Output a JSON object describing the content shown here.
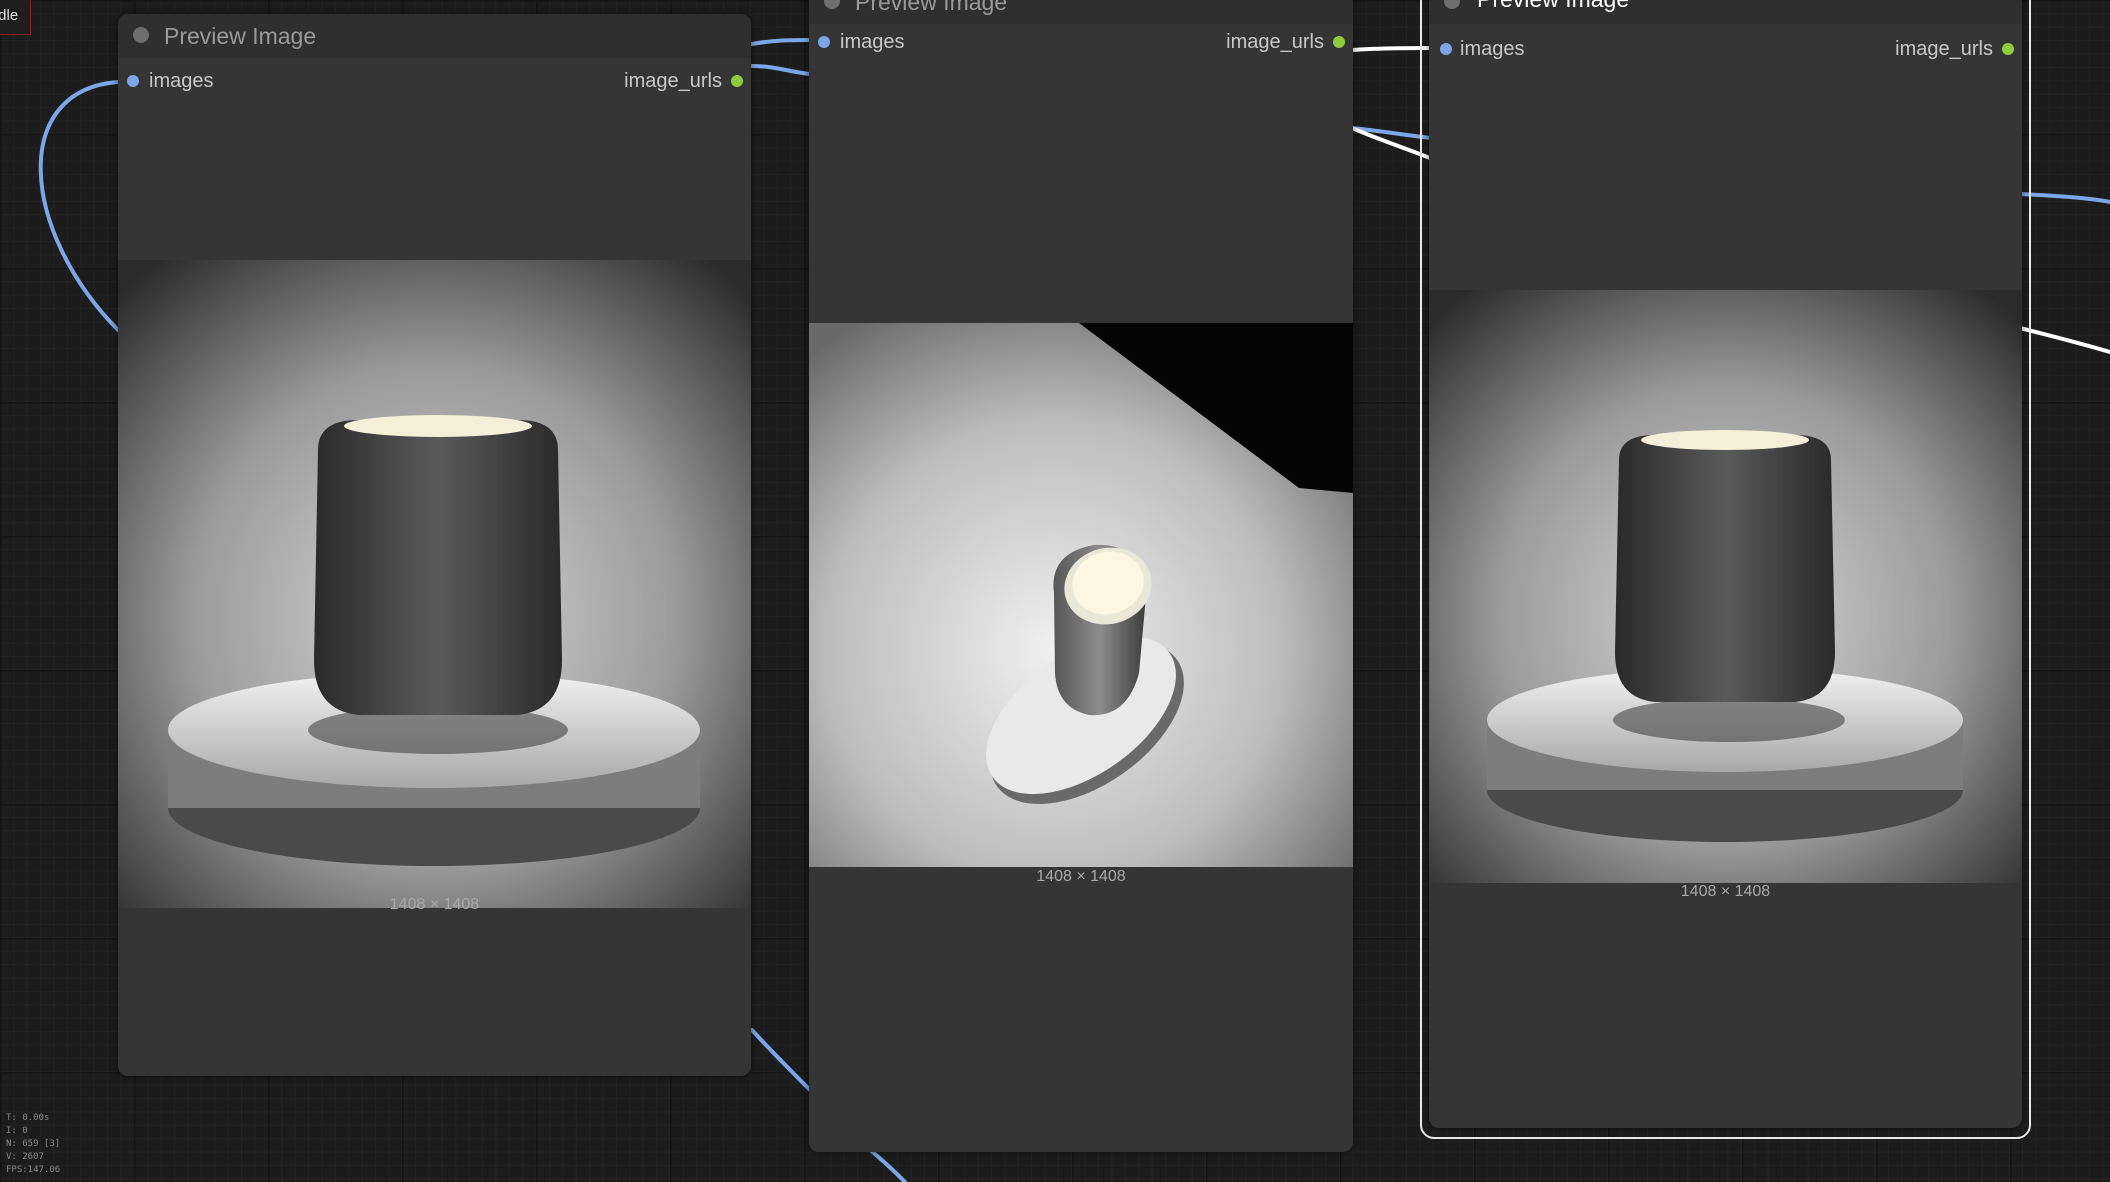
{
  "canvas": {
    "status": "Idle",
    "stats": [
      "T: 0.00s",
      "I: 0",
      "N: 659 [3]",
      "V: 2607",
      "FPS:147.06"
    ]
  },
  "nodes": [
    {
      "title": "Preview Image",
      "input_label": "images",
      "output_label": "image_urls",
      "image_dims": "1408 × 1408",
      "image_subject": "homepod-on-pedestal-front"
    },
    {
      "title": "Preview Image",
      "input_label": "images",
      "output_label": "image_urls",
      "image_dims": "1408 × 1408",
      "image_subject": "homepod-on-pedestal-top-angle"
    },
    {
      "title": "Preview Image",
      "input_label": "images",
      "output_label": "image_urls",
      "image_dims": "1408 × 1408",
      "image_subject": "homepod-on-pedestal-front"
    }
  ],
  "colors": {
    "input_slot": "#7aa7e8",
    "output_slot": "#8fcc3c",
    "link_blue": "#7aa7e8",
    "link_white": "#ffffff",
    "node_body": "#353535",
    "canvas": "#1c1c1c"
  }
}
